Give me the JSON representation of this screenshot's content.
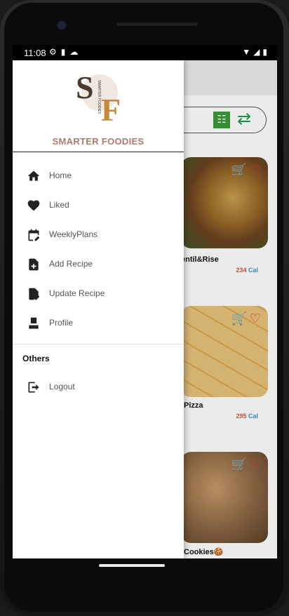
{
  "statusbar": {
    "time": "11:08",
    "left_icons": [
      "settings-icon",
      "sim-card-icon",
      "cloud-icon"
    ],
    "right_icons": [
      "wifi-icon",
      "signal-icon",
      "battery-icon"
    ]
  },
  "drawer": {
    "brand": "SMARTER FOODIES",
    "logo": {
      "initials": "SF",
      "vertical_text": "SMARTER FOODIES",
      "colors": [
        "#4a3a2e",
        "#c48a3a",
        "#efe8e2"
      ]
    },
    "menu": [
      {
        "label": "Home",
        "icon": "home-icon"
      },
      {
        "label": "Liked",
        "icon": "heart-icon"
      },
      {
        "label": "WeeklyPlans",
        "icon": "calendar-edit-icon"
      },
      {
        "label": "Add Recipe",
        "icon": "add-document-icon"
      },
      {
        "label": "Update Recipe",
        "icon": "edit-document-icon"
      },
      {
        "label": "Profile",
        "icon": "person-icon"
      }
    ],
    "others_title": "Others",
    "logout_label": "Logout"
  },
  "background": {
    "cards": [
      {
        "title": "entil&Rise",
        "cal_value": "234",
        "cal_unit": "Cal"
      },
      {
        "title": "Pizza",
        "cal_value": "295",
        "cal_unit": "Cal"
      },
      {
        "title": "Cookies🍪",
        "cal_value": "",
        "cal_unit": ""
      }
    ]
  },
  "colors": {
    "brand": "#b07a6e",
    "accent_green": "#2f9a2f",
    "like_red": "#e33333"
  }
}
